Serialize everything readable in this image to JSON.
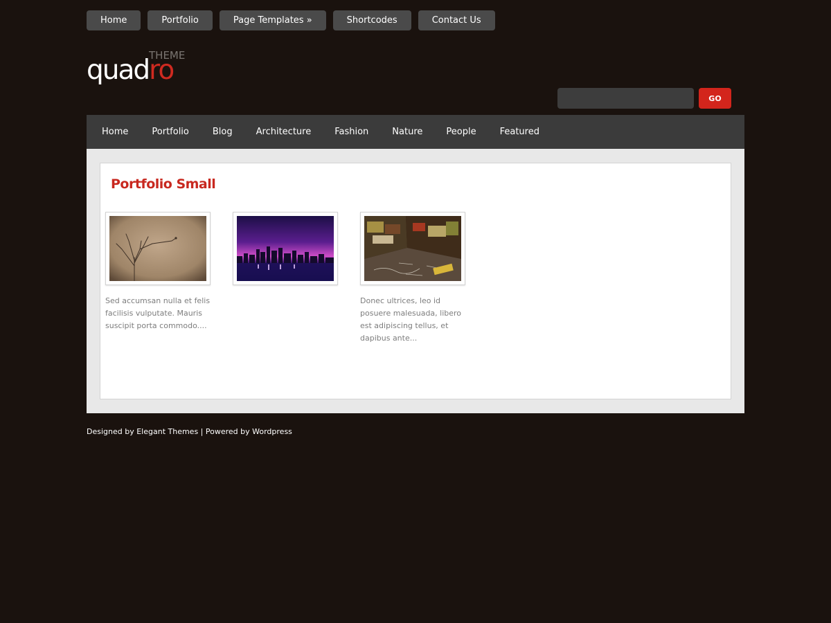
{
  "top_nav": {
    "items": [
      {
        "label": "Home"
      },
      {
        "label": "Portfolio"
      },
      {
        "label": "Page Templates »"
      },
      {
        "label": "Shortcodes"
      },
      {
        "label": "Contact Us"
      }
    ]
  },
  "logo": {
    "main_white": "quad",
    "main_accent": "ro",
    "sub": "THEME"
  },
  "search": {
    "value": "",
    "placeholder": "",
    "button_label": "GO"
  },
  "main_nav": {
    "items": [
      {
        "label": "Home"
      },
      {
        "label": "Portfolio"
      },
      {
        "label": "Blog"
      },
      {
        "label": "Architecture"
      },
      {
        "label": "Fashion"
      },
      {
        "label": "Nature"
      },
      {
        "label": "People"
      },
      {
        "label": "Featured"
      }
    ]
  },
  "content": {
    "title": "Portfolio Small",
    "items": [
      {
        "image": "bare-tree",
        "description": "Sed accumsan nulla et felis facilisis vulputate. Mauris suscipit porta commodo...."
      },
      {
        "image": "night-city-skyline",
        "description": ""
      },
      {
        "image": "graffiti-room",
        "description": "Donec ultrices, leo id posuere malesuada, libero est adipiscing tellus, et dapibus ante..."
      }
    ]
  },
  "footer": {
    "designed_prefix": "Designed by ",
    "designed_link": "Elegant Themes",
    "separator": " | ",
    "powered_prefix": "Powered by ",
    "powered_link": "Wordpress"
  },
  "colors": {
    "background": "#1a120e",
    "accent": "#cf2a20",
    "nav_bar": "#3b3b3b",
    "button": "#4a4a4a"
  }
}
